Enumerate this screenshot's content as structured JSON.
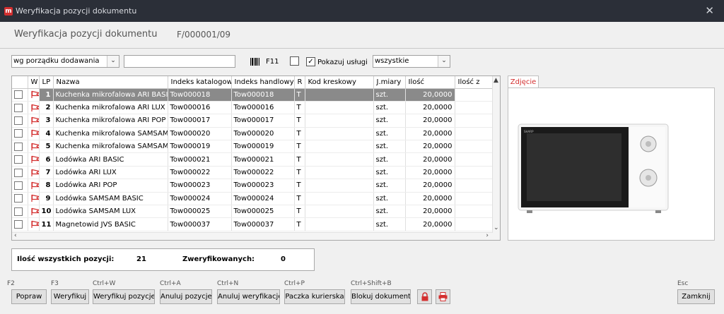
{
  "window": {
    "title": "Weryfikacja pozycji dokumentu",
    "app_icon": "m"
  },
  "header": {
    "title": "Weryfikacja pozycji dokumentu",
    "doc_number": "F/000001/09"
  },
  "toolbar": {
    "sort_value": "wg porządku dodawania",
    "search_value": "",
    "f11_label": "F11",
    "show_services_label": "Pokazuj usługi",
    "show_services_checked": "✓",
    "filter_value": "wszystkie"
  },
  "grid": {
    "columns": [
      "W",
      "LP",
      "Nazwa",
      "Indeks katalogowy",
      "Indeks handlowy",
      "R",
      "Kod kreskowy",
      "J.miary",
      "Ilość",
      "Ilość z"
    ],
    "rows": [
      {
        "lp": "1",
        "name": "Kuchenka mikrofalowa ARI BASIC",
        "idx_cat": "Tow000018",
        "idx_trade": "Tow000018",
        "r": "T",
        "barcode": "",
        "unit": "szt.",
        "qty": "20,0000"
      },
      {
        "lp": "2",
        "name": "Kuchenka mikrofalowa ARI LUX",
        "idx_cat": "Tow000016",
        "idx_trade": "Tow000016",
        "r": "T",
        "barcode": "",
        "unit": "szt.",
        "qty": "20,0000"
      },
      {
        "lp": "3",
        "name": "Kuchenka mikrofalowa ARI POP",
        "idx_cat": "Tow000017",
        "idx_trade": "Tow000017",
        "r": "T",
        "barcode": "",
        "unit": "szt.",
        "qty": "20,0000"
      },
      {
        "lp": "4",
        "name": "Kuchenka mikrofalowa SAMSAM BAS",
        "idx_cat": "Tow000020",
        "idx_trade": "Tow000020",
        "r": "T",
        "barcode": "",
        "unit": "szt.",
        "qty": "20,0000"
      },
      {
        "lp": "5",
        "name": "Kuchenka mikrofalowa SAMSAM LU)",
        "idx_cat": "Tow000019",
        "idx_trade": "Tow000019",
        "r": "T",
        "barcode": "",
        "unit": "szt.",
        "qty": "20,0000"
      },
      {
        "lp": "6",
        "name": "Lodówka ARI BASIC",
        "idx_cat": "Tow000021",
        "idx_trade": "Tow000021",
        "r": "T",
        "barcode": "",
        "unit": "szt.",
        "qty": "20,0000"
      },
      {
        "lp": "7",
        "name": "Lodówka ARI LUX",
        "idx_cat": "Tow000022",
        "idx_trade": "Tow000022",
        "r": "T",
        "barcode": "",
        "unit": "szt.",
        "qty": "20,0000"
      },
      {
        "lp": "8",
        "name": "Lodówka ARI POP",
        "idx_cat": "Tow000023",
        "idx_trade": "Tow000023",
        "r": "T",
        "barcode": "",
        "unit": "szt.",
        "qty": "20,0000"
      },
      {
        "lp": "9",
        "name": "Lodówka SAMSAM BASIC",
        "idx_cat": "Tow000024",
        "idx_trade": "Tow000024",
        "r": "T",
        "barcode": "",
        "unit": "szt.",
        "qty": "20,0000"
      },
      {
        "lp": "10",
        "name": "Lodówka SAMSAM LUX",
        "idx_cat": "Tow000025",
        "idx_trade": "Tow000025",
        "r": "T",
        "barcode": "",
        "unit": "szt.",
        "qty": "20,0000"
      },
      {
        "lp": "11",
        "name": "Magnetowid JVS BASIC",
        "idx_cat": "Tow000037",
        "idx_trade": "Tow000037",
        "r": "T",
        "barcode": "",
        "unit": "szt.",
        "qty": "20,0000"
      }
    ],
    "selected_row": 0
  },
  "photo_panel": {
    "tab_label": "Zdjęcie",
    "brand_text": "SHARP"
  },
  "summary": {
    "total_label": "Ilość wszystkich pozycji:",
    "total_value": "21",
    "verified_label": "Zweryfikowanych:",
    "verified_value": "0"
  },
  "buttons": [
    {
      "key": "F2",
      "label": "Popraw"
    },
    {
      "key": "F3",
      "label": "Weryfikuj"
    },
    {
      "key": "Ctrl+W",
      "label": "Weryfikuj pozycje"
    },
    {
      "key": "Ctrl+A",
      "label": "Anuluj pozycje"
    },
    {
      "key": "Ctrl+N",
      "label": "Anuluj weryfikację"
    },
    {
      "key": "Ctrl+P",
      "label": "Paczka kurierska"
    },
    {
      "key": "Ctrl+Shift+B",
      "label": "Blokuj dokument"
    }
  ],
  "close_button": {
    "key": "Esc",
    "label": "Zamknij"
  },
  "icons": {
    "lock": "lock-icon",
    "print": "printer-icon",
    "flag": "flag-icon"
  },
  "colors": {
    "accent": "#d32f2f",
    "selected_row": "#8a8a8a",
    "titlebar": "#2b2f38"
  }
}
